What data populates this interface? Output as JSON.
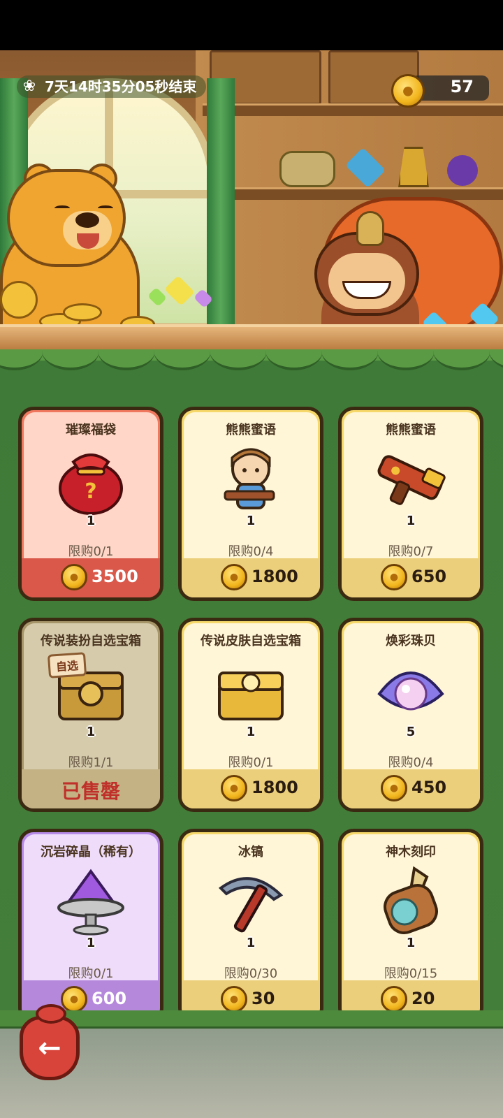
{
  "timer": {
    "text": "7天14时35分05秒结束",
    "icon": "paw-icon"
  },
  "currency": {
    "amount": "57",
    "icon": "paw-coin-icon"
  },
  "items": [
    {
      "title": "璀璨福袋",
      "icon": "lucky-bag-icon",
      "qty": "1",
      "limit": "限购0/1",
      "price": "3500",
      "style": "red"
    },
    {
      "title": "熊熊蜜语",
      "icon": "character-skin-icon",
      "qty": "1",
      "limit": "限购0/4",
      "price": "1800",
      "style": "cream"
    },
    {
      "title": "熊熊蜜语",
      "icon": "blaster-weapon-icon",
      "qty": "1",
      "limit": "限购0/7",
      "price": "650",
      "style": "cream"
    },
    {
      "title": "传说装扮自选宝箱",
      "icon": "legendary-chest-icon",
      "tag": "自选",
      "qty": "1",
      "limit": "限购1/1",
      "sold": "已售罄",
      "style": "sold"
    },
    {
      "title": "传说皮肤自选宝箱",
      "icon": "golden-chest-icon",
      "qty": "1",
      "limit": "限购0/1",
      "price": "1800",
      "style": "cream"
    },
    {
      "title": "焕彩珠贝",
      "icon": "pearl-shell-icon",
      "qty": "5",
      "limit": "限购0/4",
      "price": "450",
      "style": "cream"
    },
    {
      "title": "沉岩碎晶（稀有）",
      "icon": "purple-crystal-icon",
      "qty": "1",
      "limit": "限购0/1",
      "price": "600",
      "style": "purple"
    },
    {
      "title": "冰镐",
      "icon": "pickaxe-icon",
      "qty": "1",
      "limit": "限购0/30",
      "price": "30",
      "style": "cream"
    },
    {
      "title": "神木刻印",
      "icon": "wood-seal-icon",
      "qty": "1",
      "limit": "限购0/15",
      "price": "20",
      "style": "cream"
    }
  ],
  "back_button": {
    "icon": "back-arrow-icon"
  }
}
